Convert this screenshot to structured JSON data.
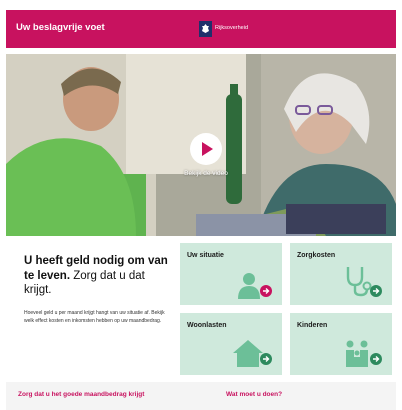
{
  "header": {
    "site_title": "Uw beslagvrije voet",
    "gov_label": "Rijksoverheid",
    "brand_color": "#c8125f"
  },
  "hero": {
    "video_label": "Bekijk de video",
    "play_icon": "play-icon"
  },
  "intro": {
    "heading_bold": "U heeft geld nodig om van te leven.",
    "heading_rest": "Zorg dat u dat krijgt.",
    "text": "Hoeveel geld u per maand krijgt hangt van uw situatie af. Bekijk welk effect kosten en inkomsten hebben op uw maandbedrag."
  },
  "tiles": [
    {
      "label": "Uw situatie",
      "icon": "person-icon",
      "arrow_color": "#c8125f"
    },
    {
      "label": "Zorgkosten",
      "icon": "stethoscope-icon",
      "arrow_color": "#2d8a5e"
    },
    {
      "label": "Woonlasten",
      "icon": "house-icon",
      "arrow_color": "#2d8a5e"
    },
    {
      "label": "Kinderen",
      "icon": "family-icon",
      "arrow_color": "#2d8a5e"
    }
  ],
  "tile_color": "#cfe9dc",
  "icon_color": "#6cbf98",
  "bottom": {
    "link_left": "Zorg dat u het goede maandbedrag krijgt",
    "link_right": "Wat moet u doen?"
  }
}
